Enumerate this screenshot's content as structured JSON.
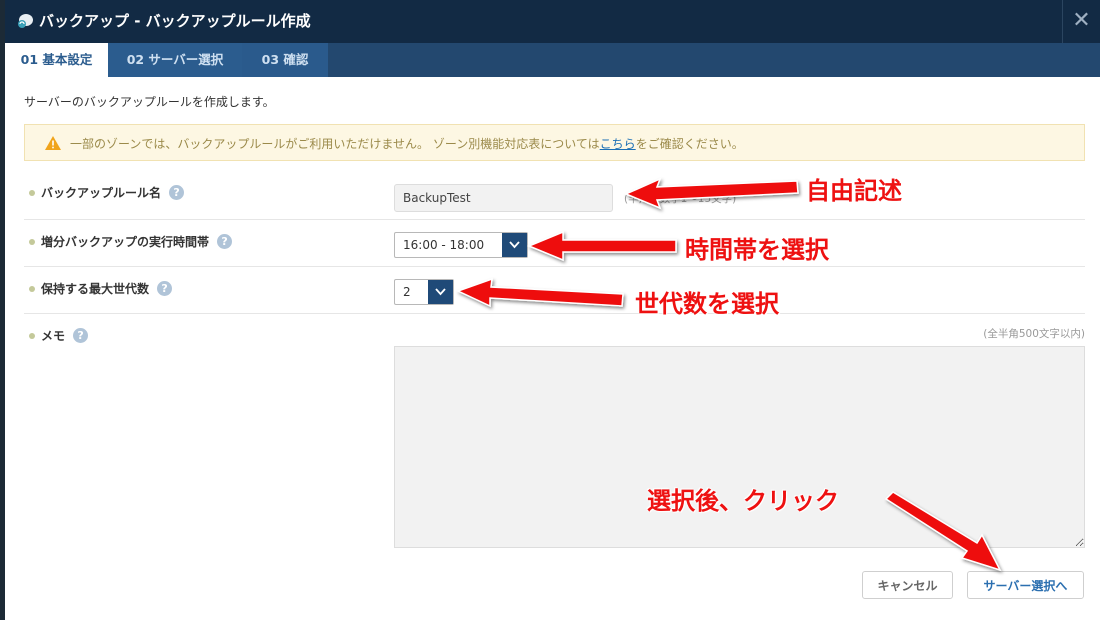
{
  "dialog": {
    "title": "バックアップ - バックアップルール作成",
    "close_label": "✕"
  },
  "tabs": [
    {
      "label": "01 基本設定",
      "active": true
    },
    {
      "label": "02 サーバー選択",
      "active": false
    },
    {
      "label": "03 確認",
      "active": false
    }
  ],
  "intro_text": "サーバーのバックアップルールを作成します。",
  "notice": {
    "text_before": "一部のゾーンでは、バックアップルールがご利用いただけません。 ゾーン別機能対応表については",
    "link_text": "こちら",
    "text_after": "をご確認ください。"
  },
  "form": {
    "rule_name": {
      "label": "バックアップルール名",
      "value": "BackupTest",
      "hint": "(半角英数字1〜15文字)"
    },
    "time_window": {
      "label": "増分バックアップの実行時間帯",
      "value": "16:00 - 18:00"
    },
    "generations": {
      "label": "保持する最大世代数",
      "value": "2"
    },
    "memo": {
      "label": "メモ",
      "hint": "(全半角500文字以内)",
      "value": ""
    }
  },
  "buttons": {
    "cancel": "キャンセル",
    "next": "サーバー選択へ"
  },
  "annotations": {
    "free_text": "自由記述",
    "select_time": "時間帯を選択",
    "select_generations": "世代数を選択",
    "after_select_click": "選択後、クリック"
  },
  "colors": {
    "titlebar": "#122a44",
    "tabbar": "#2b5c8e",
    "annotation": "#ee1111",
    "select_button": "#1f4a78"
  }
}
